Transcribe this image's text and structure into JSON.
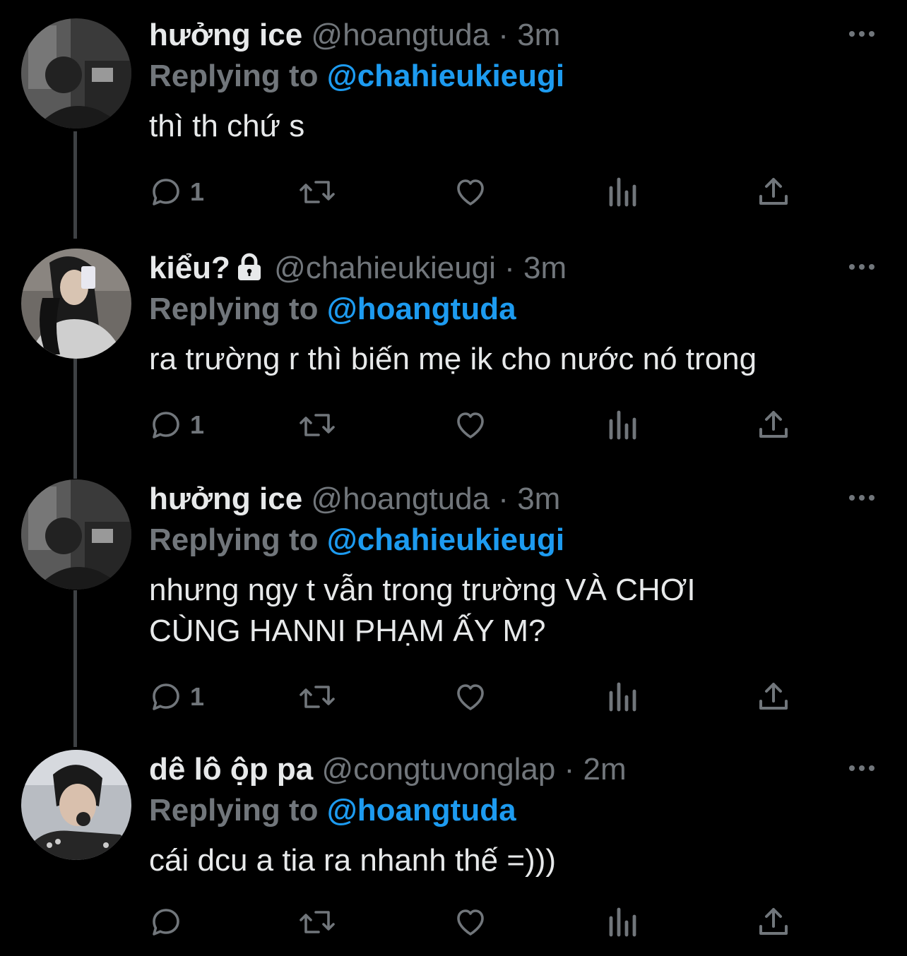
{
  "theme": {
    "background": "#000000",
    "text": "#e7e9ea",
    "muted": "#71767b",
    "accent": "#1d9bf0",
    "thread_line": "#3e4144"
  },
  "tweets": [
    {
      "display_name": "hưởng ice",
      "handle": "@hoangtuda",
      "dot": "·",
      "time": "3m",
      "replying_label": "Replying to",
      "replying_to": "@chahieukieugi",
      "text_lines": [
        "thì th chứ s"
      ],
      "reply_count": "1",
      "locked": false,
      "avatar_icon": "avatar-photo-dark-room"
    },
    {
      "display_name": "kiểu?",
      "handle": "@chahieukieugi",
      "dot": "·",
      "time": "3m",
      "replying_label": "Replying to",
      "replying_to": "@hoangtuda",
      "text_lines": [
        "ra trường r thì biến mẹ ik cho nước nó trong"
      ],
      "reply_count": "1",
      "locked": true,
      "avatar_icon": "avatar-photo-mirror-selfie"
    },
    {
      "display_name": "hưởng ice",
      "handle": "@hoangtuda",
      "dot": "·",
      "time": "3m",
      "replying_label": "Replying to",
      "replying_to": "@chahieukieugi",
      "text_lines": [
        "nhưng ngy t vẫn trong trường VÀ CHƠI",
        "CÙNG HANNI PHẠM ẤY M?"
      ],
      "reply_count": "1",
      "locked": false,
      "avatar_icon": "avatar-photo-dark-room"
    },
    {
      "display_name": "dê lô ộp pa",
      "handle": "@congtuvonglap",
      "dot": "·",
      "time": "2m",
      "replying_label": "Replying to",
      "replying_to": "@hoangtuda",
      "text_lines": [
        "cái dcu a tia ra nhanh thế =)))"
      ],
      "reply_count": "",
      "locked": false,
      "avatar_icon": "avatar-photo-singer-mic"
    }
  ],
  "icons": {
    "reply": "reply-icon",
    "retweet": "retweet-icon",
    "like": "heart-icon",
    "views": "views-icon",
    "share": "share-icon",
    "more": "more-icon",
    "lock": "lock-icon"
  }
}
